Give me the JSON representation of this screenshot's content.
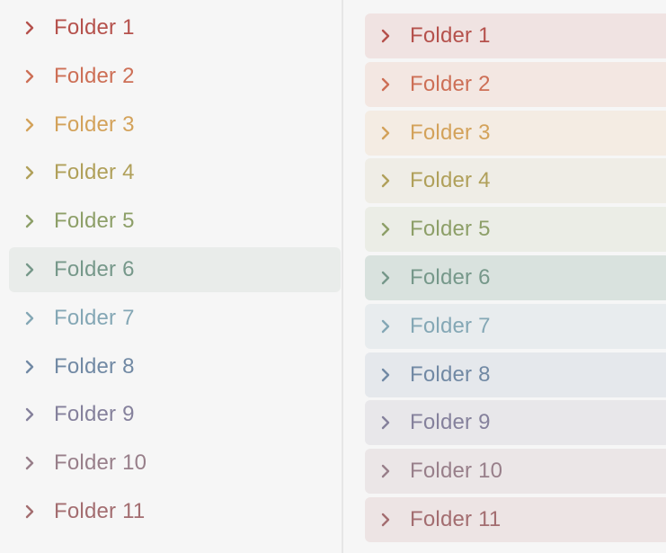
{
  "left_panel": {
    "items": [
      {
        "label": "Folder 1",
        "color": "#b5514c",
        "active": false
      },
      {
        "label": "Folder 2",
        "color": "#cd6f56",
        "active": false
      },
      {
        "label": "Folder 3",
        "color": "#d3a25a",
        "active": false
      },
      {
        "label": "Folder 4",
        "color": "#b0a05a",
        "active": false
      },
      {
        "label": "Folder 5",
        "color": "#8d9f68",
        "active": false
      },
      {
        "label": "Folder 6",
        "color": "#76988a",
        "active": true
      },
      {
        "label": "Folder 7",
        "color": "#84a7b5",
        "active": false
      },
      {
        "label": "Folder 8",
        "color": "#7189a4",
        "active": false
      },
      {
        "label": "Folder 9",
        "color": "#85819c",
        "active": false
      },
      {
        "label": "Folder 10",
        "color": "#987f8a",
        "active": false
      },
      {
        "label": "Folder 11",
        "color": "#a36d70",
        "active": false
      }
    ],
    "active_bg": "#e9ecea"
  },
  "right_panel": {
    "items": [
      {
        "label": "Folder 1",
        "color": "#b5514c",
        "bg": "#f0e3e2"
      },
      {
        "label": "Folder 2",
        "color": "#cd6f56",
        "bg": "#f3e7e2"
      },
      {
        "label": "Folder 3",
        "color": "#d3a25a",
        "bg": "#f4ece3"
      },
      {
        "label": "Folder 4",
        "color": "#b0a05a",
        "bg": "#efede6"
      },
      {
        "label": "Folder 5",
        "color": "#8d9f68",
        "bg": "#ebede6"
      },
      {
        "label": "Folder 6",
        "color": "#76988a",
        "bg": "#d9e2de"
      },
      {
        "label": "Folder 7",
        "color": "#84a7b5",
        "bg": "#e8ecee"
      },
      {
        "label": "Folder 8",
        "color": "#7189a4",
        "bg": "#e5e8ec"
      },
      {
        "label": "Folder 9",
        "color": "#85819c",
        "bg": "#e8e7ea"
      },
      {
        "label": "Folder 10",
        "color": "#987f8a",
        "bg": "#ebe6e7"
      },
      {
        "label": "Folder 11",
        "color": "#a36d70",
        "bg": "#ede4e4"
      }
    ]
  },
  "icons": {
    "chevron": "chevron-right-icon"
  },
  "colors": {
    "background": "#f6f6f6",
    "divider": "#e6e6e6"
  }
}
